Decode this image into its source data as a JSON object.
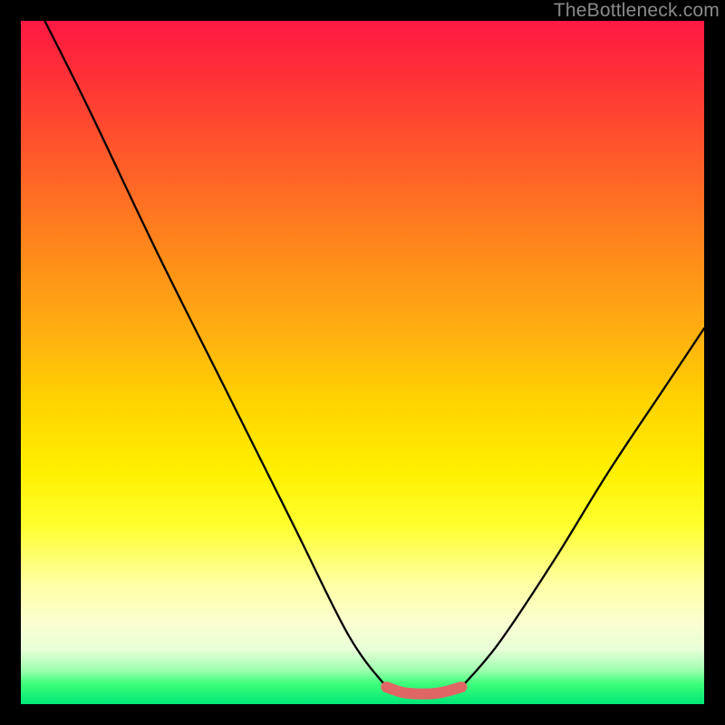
{
  "watermark": {
    "text": "TheBottleneck.com"
  },
  "chart_data": {
    "type": "line",
    "title": "",
    "xlabel": "",
    "ylabel": "",
    "xlim": [
      0,
      1
    ],
    "ylim": [
      0,
      1
    ],
    "series": [
      {
        "name": "curve-left",
        "x": [
          0.035,
          0.1,
          0.2,
          0.3,
          0.4,
          0.48,
          0.535
        ],
        "y": [
          1.0,
          0.87,
          0.66,
          0.46,
          0.26,
          0.1,
          0.025
        ]
      },
      {
        "name": "curve-right",
        "x": [
          0.645,
          0.7,
          0.78,
          0.86,
          0.94,
          1.0
        ],
        "y": [
          0.025,
          0.09,
          0.21,
          0.34,
          0.46,
          0.55
        ]
      },
      {
        "name": "flat-bottom",
        "x": [
          0.535,
          0.56,
          0.59,
          0.615,
          0.645
        ],
        "y": [
          0.025,
          0.017,
          0.015,
          0.017,
          0.025
        ]
      }
    ],
    "annotations": [
      {
        "name": "bottom-highlight",
        "color": "#e06666",
        "thickness_ratio": 0.016
      }
    ],
    "background_gradient_stops": [
      {
        "pos": 0.0,
        "color": "#ff1a44"
      },
      {
        "pos": 0.5,
        "color": "#ffd400"
      },
      {
        "pos": 0.85,
        "color": "#ffffa0"
      },
      {
        "pos": 1.0,
        "color": "#00e676"
      }
    ]
  }
}
